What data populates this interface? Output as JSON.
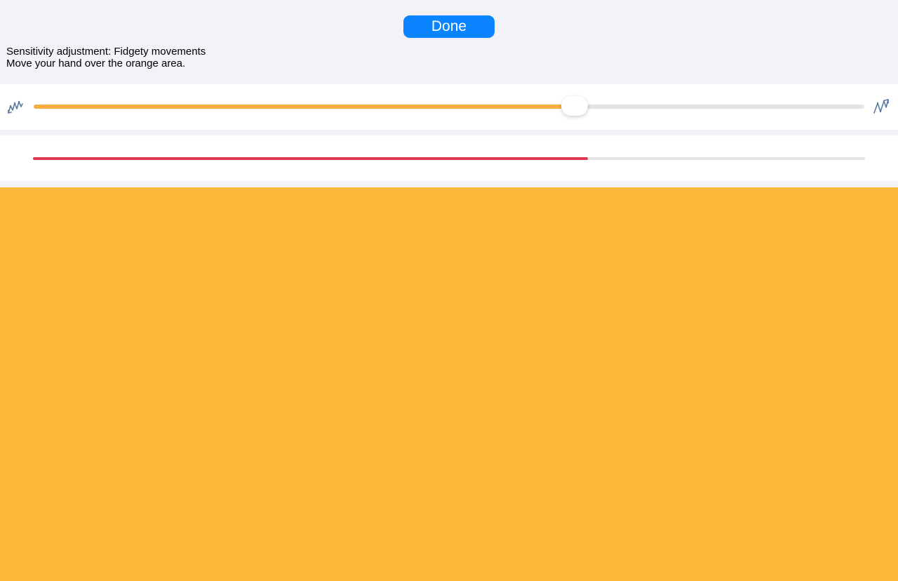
{
  "header": {
    "done_label": "Done",
    "title": "Sensitivity adjustment: Fidgety movements",
    "instruction": "Move your hand over the orange area."
  },
  "sensitivity_slider": {
    "value": 0.651,
    "left_icon": "fidgety-low-icon",
    "right_icon": "fidgety-high-icon",
    "fill_color": "#f5b041",
    "track_color": "#e3e3e6"
  },
  "motion_meter": {
    "value": 0.667,
    "fill_color": "#e0394f",
    "track_color": "#e3e3e6"
  },
  "target_area": {
    "color": "#fdb73a"
  },
  "colors": {
    "accent": "#0a84ff",
    "background": "#f2f2f7"
  }
}
